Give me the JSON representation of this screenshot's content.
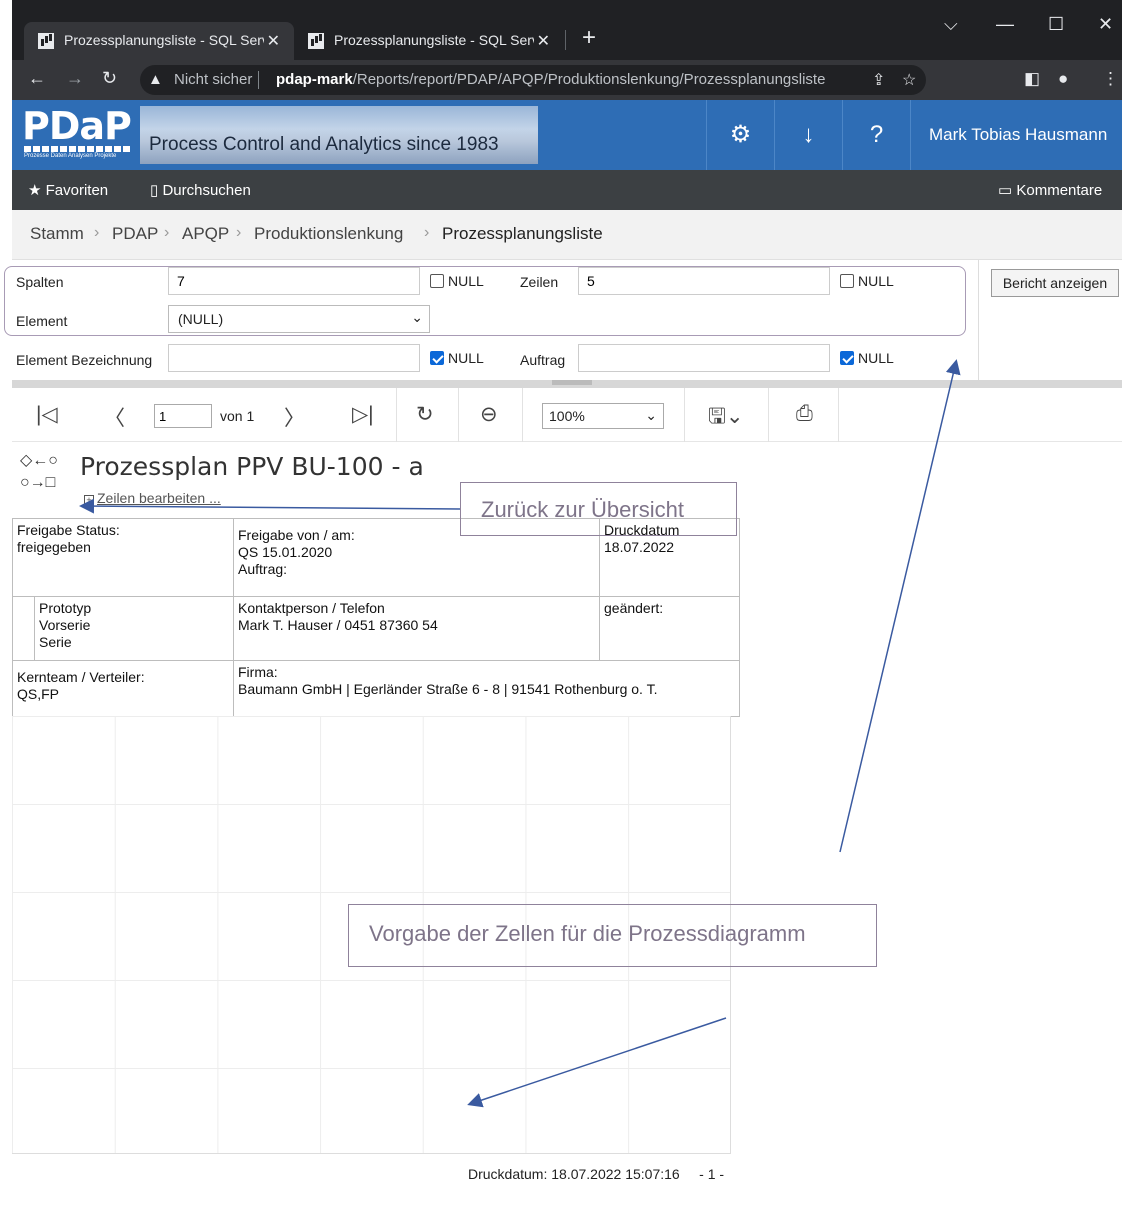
{
  "browser": {
    "tabs": [
      {
        "title": "Prozessplanungsliste - SQL Serve",
        "active": true
      },
      {
        "title": "Prozessplanungsliste - SQL Serve",
        "active": false
      }
    ],
    "address": {
      "security": "Nicht sicher",
      "host": "pdap-mark",
      "path": "/Reports/report/PDAP/APQP/Produktionslenkung/Prozessplanungsliste"
    }
  },
  "app": {
    "logo_text": "PDaP",
    "logo_tagline": "Prozesse Daten Analysen Projekte",
    "slogan": "Process Control and Analytics since 1983",
    "user": "Mark Tobias Hausmann",
    "menu": {
      "favorites": "Favoriten",
      "browse": "Durchsuchen",
      "comments": "Kommentare"
    }
  },
  "breadcrumb": [
    "Stamm",
    "PDAP",
    "APQP",
    "Produktionslenkung",
    "Prozessplanungsliste"
  ],
  "params": {
    "spalten": {
      "label": "Spalten",
      "value": "7"
    },
    "zeilen": {
      "label": "Zeilen",
      "value": "5"
    },
    "element": {
      "label": "Element",
      "value": "(NULL)"
    },
    "element_bez": {
      "label": "Element Bezeichnung",
      "value": ""
    },
    "auftrag": {
      "label": "Auftrag",
      "value": ""
    },
    "null_label": "NULL",
    "view_button": "Bericht anzeigen"
  },
  "toolbar": {
    "page": "1",
    "of_label": "von 1",
    "zoom": "100%"
  },
  "report": {
    "title": "Prozessplan PPV BU-100 - a",
    "edit_link": "Zeilen bearbeiten ...",
    "freigabe_status_label": "Freigabe Status:",
    "freigabe_status_value": "freigegeben",
    "freigabe_von_label": "Freigabe von / am:",
    "freigabe_von_value": "QS 15.01.2020",
    "auftrag_label": "Auftrag:",
    "druckdatum_label": "Druckdatum",
    "druckdatum_value": "18.07.2022",
    "phases": [
      "Prototyp",
      "Vorserie",
      "Serie"
    ],
    "kontakt_label": "Kontaktperson / Telefon",
    "kontakt_value": "Mark T. Hauser / 0451 87360 54",
    "geaendert_label": "geändert:",
    "kernteam_label": "Kernteam / Verteiler:",
    "kernteam_value": "QS,FP",
    "firma_label": "Firma:",
    "firma_value": "Baumann GmbH | Egerländer Straße 6 - 8 | 91541 Rothenburg o. T.",
    "footer": "Druckdatum: 18.07.2022 15:07:16     - 1 -"
  },
  "annotations": {
    "back": "Zurück zur Übersicht",
    "cells": "Vorgabe der Zellen für die Prozessdiagramm"
  },
  "colors": {
    "header_blue": "#2e6db5",
    "menu_dark": "#3c4043",
    "callout_border": "#8f829b",
    "arrow": "#3a5aa0"
  }
}
